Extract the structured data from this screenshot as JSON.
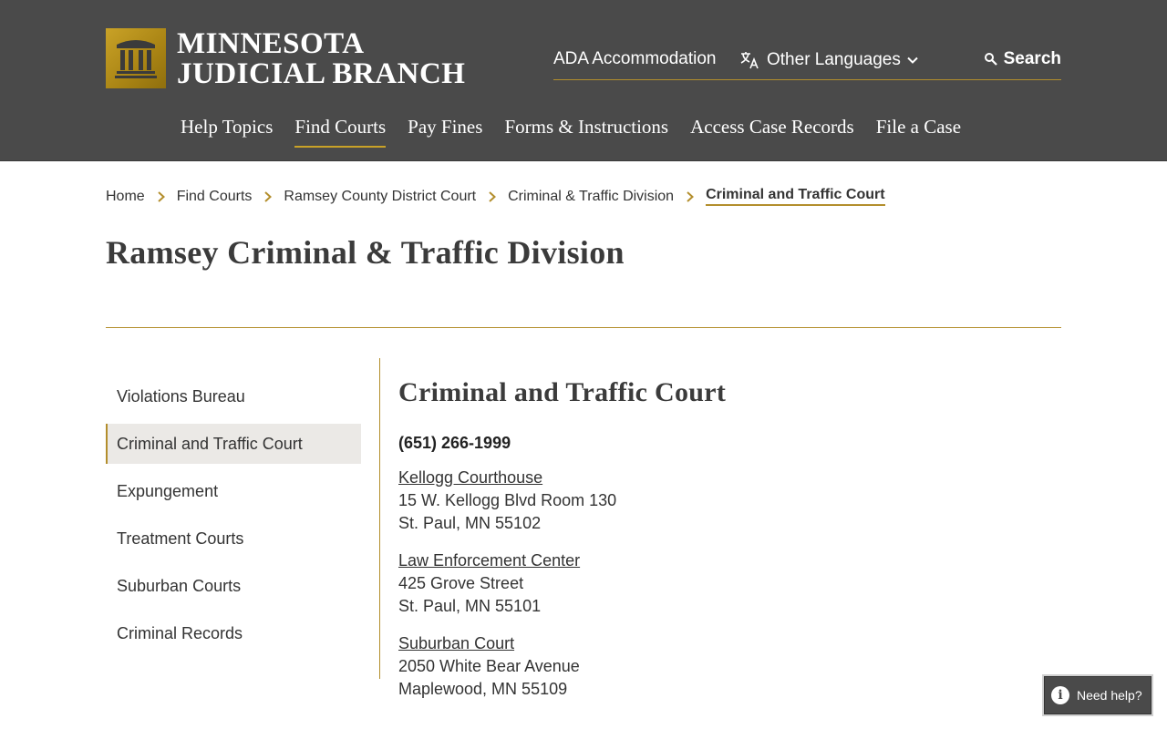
{
  "header": {
    "logo_line1": "MINNESOTA",
    "logo_line2": "JUDICIAL BRANCH",
    "utility": {
      "ada": "ADA Accommodation",
      "languages": "Other Languages",
      "search": "Search"
    },
    "nav": [
      "Help Topics",
      "Find Courts",
      "Pay Fines",
      "Forms & Instructions",
      "Access Case Records",
      "File a Case"
    ],
    "active_nav": "Find Courts"
  },
  "breadcrumb": [
    "Home",
    "Find Courts",
    "Ramsey County District Court",
    "Criminal & Traffic Division",
    "Criminal and Traffic Court"
  ],
  "page_title": "Ramsey Criminal & Traffic Division",
  "sidebar": {
    "items": [
      "Violations Bureau",
      "Criminal and Traffic Court",
      "Expungement",
      "Treatment Courts",
      "Suburban Courts",
      "Criminal Records"
    ],
    "active": "Criminal and Traffic Court"
  },
  "content": {
    "heading": "Criminal and Traffic Court",
    "phone": "(651) 266-1999",
    "locations": [
      {
        "name": "Kellogg Courthouse",
        "street": "15 W. Kellogg Blvd Room 130",
        "city": "St. Paul, MN 55102"
      },
      {
        "name": "Law Enforcement Center",
        "street": "425 Grove Street",
        "city": "St. Paul, MN 55101"
      },
      {
        "name": "Suburban Court",
        "street": "2050 White Bear Avenue",
        "city": "Maplewood, MN 55109"
      }
    ]
  },
  "help": {
    "label": "Need help?",
    "icon": "i"
  },
  "colors": {
    "header_bg": "#4a4a4a",
    "accent_gold": "#b38e2c",
    "active_bg": "#ebe9e6"
  }
}
